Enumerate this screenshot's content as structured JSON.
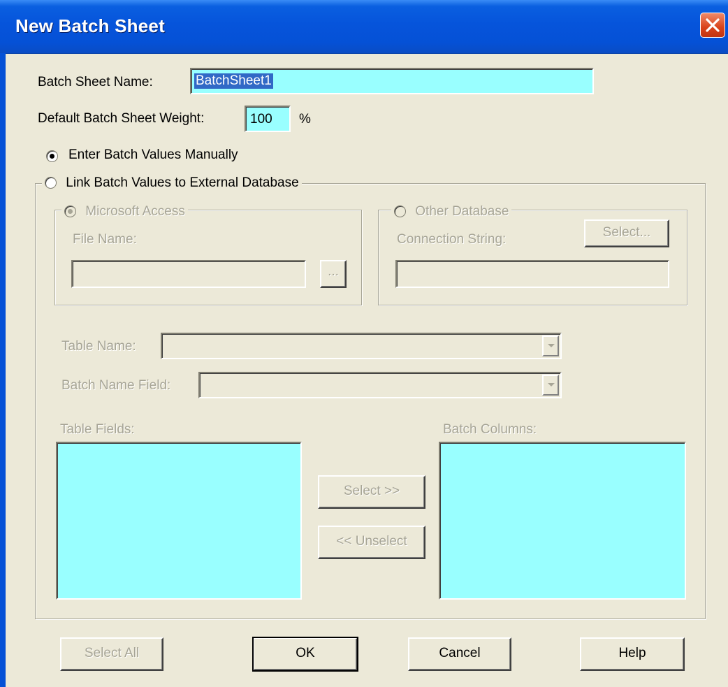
{
  "window": {
    "title": "New Batch Sheet"
  },
  "batch_sheet_name": {
    "label": "Batch Sheet Name:",
    "value": "BatchSheet1"
  },
  "default_weight": {
    "label": "Default Batch Sheet Weight:",
    "value": "100",
    "unit": "%"
  },
  "mode": {
    "manual_label": "Enter Batch Values Manually",
    "manual_selected": true,
    "external_label": "Link Batch Values to External Database",
    "external_selected": false
  },
  "ms_access": {
    "legend": "Microsoft Access",
    "file_name_label": "File Name:",
    "file_name_value": "",
    "browse_label": "..."
  },
  "other_db": {
    "legend": "Other Database",
    "connection_string_label": "Connection String:",
    "connection_string_value": "",
    "select_button": "Select..."
  },
  "table_name": {
    "label": "Table Name:",
    "value": ""
  },
  "batch_name_field": {
    "label": "Batch Name Field:",
    "value": ""
  },
  "table_fields": {
    "label": "Table Fields:",
    "items": []
  },
  "batch_columns": {
    "label": "Batch Columns:",
    "items": []
  },
  "buttons": {
    "select": "Select   >>",
    "unselect": "<<  Unselect",
    "select_all": "Select All",
    "ok": "OK",
    "cancel": "Cancel",
    "help": "Help"
  },
  "colors": {
    "title_bar": "#0551D6",
    "field_cyan": "#99FFFF",
    "dialog_bg": "#ECE9D8",
    "disabled_text": "#A7A596"
  }
}
